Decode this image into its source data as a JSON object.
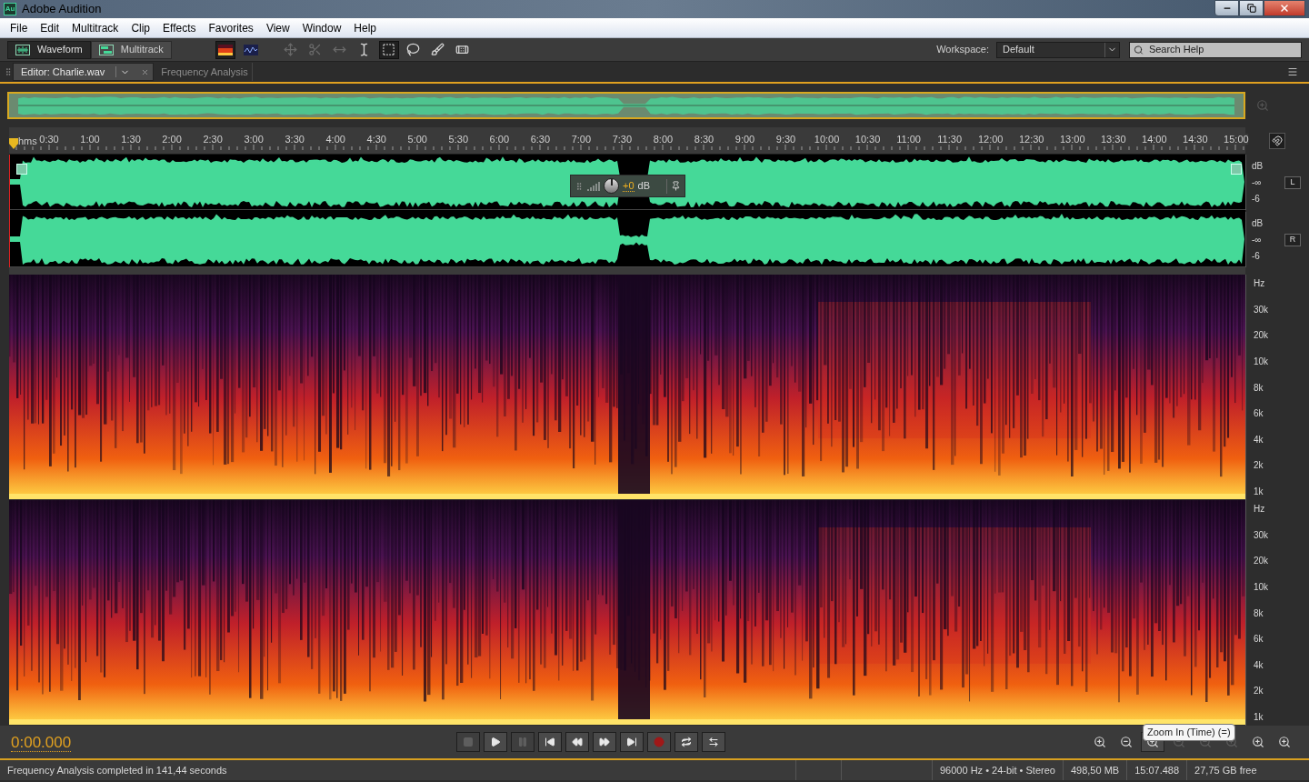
{
  "title_bar": {
    "app_icon": "Au",
    "title": "Adobe Audition"
  },
  "menu": [
    "File",
    "Edit",
    "Multitrack",
    "Clip",
    "Effects",
    "Favorites",
    "View",
    "Window",
    "Help"
  ],
  "toolbar": {
    "views": [
      {
        "kind": "waveform",
        "label": "Waveform",
        "selected": true
      },
      {
        "kind": "multitrack",
        "label": "Multitrack",
        "selected": false
      }
    ],
    "displays": [
      {
        "kind": "spectral",
        "selected": true
      },
      {
        "kind": "pitch",
        "selected": false
      }
    ],
    "tools": [
      {
        "kind": "move",
        "selected": false,
        "disabled": true
      },
      {
        "kind": "razor",
        "selected": false,
        "disabled": true
      },
      {
        "kind": "slip",
        "selected": false,
        "disabled": true
      },
      {
        "kind": "time-selection",
        "selected": false,
        "disabled": false
      },
      {
        "kind": "marquee",
        "selected": true,
        "disabled": false
      },
      {
        "kind": "lasso",
        "selected": false,
        "disabled": false
      },
      {
        "kind": "brush",
        "selected": false,
        "disabled": false
      },
      {
        "kind": "healing",
        "selected": false,
        "disabled": false
      }
    ],
    "workspace": {
      "label": "Workspace:",
      "value": "Default"
    },
    "search": {
      "placeholder": "Search Help"
    }
  },
  "tabs": [
    {
      "label": "Editor: Charlie.wav",
      "selected": true,
      "closable": true
    },
    {
      "label": "Frequency Analysis",
      "selected": false,
      "closable": false
    }
  ],
  "timeline": {
    "unit": "hms",
    "ticks": [
      "0:30",
      "1:00",
      "1:30",
      "2:00",
      "2:30",
      "3:00",
      "3:30",
      "4:00",
      "4:30",
      "5:00",
      "5:30",
      "6:00",
      "6:30",
      "7:00",
      "7:30",
      "8:00",
      "8:30",
      "9:00",
      "9:30",
      "10:00",
      "10:30",
      "11:00",
      "11:30",
      "12:00",
      "12:30",
      "13:00",
      "13:30",
      "14:00",
      "14:30",
      "15:00"
    ]
  },
  "waveform": {
    "channels": [
      {
        "name": "L",
        "scale": [
          "dB",
          "-∞",
          "-6"
        ]
      },
      {
        "name": "R",
        "scale": [
          "dB",
          "-∞",
          "-6"
        ]
      }
    ],
    "hud": {
      "gain": "+0",
      "unit": "dB"
    }
  },
  "spectrogram": {
    "channels": [
      {
        "scale": [
          "Hz",
          "30k",
          "20k",
          "10k",
          "8k",
          "6k",
          "4k",
          "2k",
          "1k"
        ]
      },
      {
        "scale": [
          "Hz",
          "30k",
          "20k",
          "10k",
          "8k",
          "6k",
          "4k",
          "2k",
          "1k"
        ]
      }
    ]
  },
  "transport": {
    "time": "0:00.000",
    "buttons": [
      {
        "kind": "stop",
        "disabled": true
      },
      {
        "kind": "play",
        "disabled": false
      },
      {
        "kind": "pause",
        "disabled": true
      },
      {
        "kind": "to-start",
        "disabled": false
      },
      {
        "kind": "rewind",
        "disabled": false
      },
      {
        "kind": "forward",
        "disabled": false
      },
      {
        "kind": "to-end",
        "disabled": false
      },
      {
        "kind": "record",
        "disabled": false
      },
      {
        "kind": "loop",
        "disabled": false
      },
      {
        "kind": "skip",
        "disabled": false
      }
    ],
    "zoom_buttons": [
      {
        "kind": "zoom-in-amplitude",
        "disabled": false,
        "hovered": false
      },
      {
        "kind": "zoom-out-amplitude",
        "disabled": false,
        "hovered": false
      },
      {
        "kind": "zoom-in-time",
        "disabled": false,
        "hovered": true
      },
      {
        "kind": "zoom-out-time",
        "disabled": true,
        "hovered": false
      },
      {
        "kind": "zoom-out-full",
        "disabled": true,
        "hovered": false
      },
      {
        "kind": "zoom-in-start",
        "disabled": true,
        "hovered": false
      },
      {
        "kind": "zoom-in-end",
        "disabled": false,
        "hovered": false
      },
      {
        "kind": "zoom-selection",
        "disabled": false,
        "hovered": false
      }
    ],
    "tooltip": "Zoom In (Time) (=)"
  },
  "status_bar": {
    "message": "Frequency Analysis completed in 141,44 seconds",
    "fields": [
      "96000 Hz • 24-bit • Stereo",
      "498,50 MB",
      "15:07.488",
      "27,75 GB free"
    ]
  }
}
